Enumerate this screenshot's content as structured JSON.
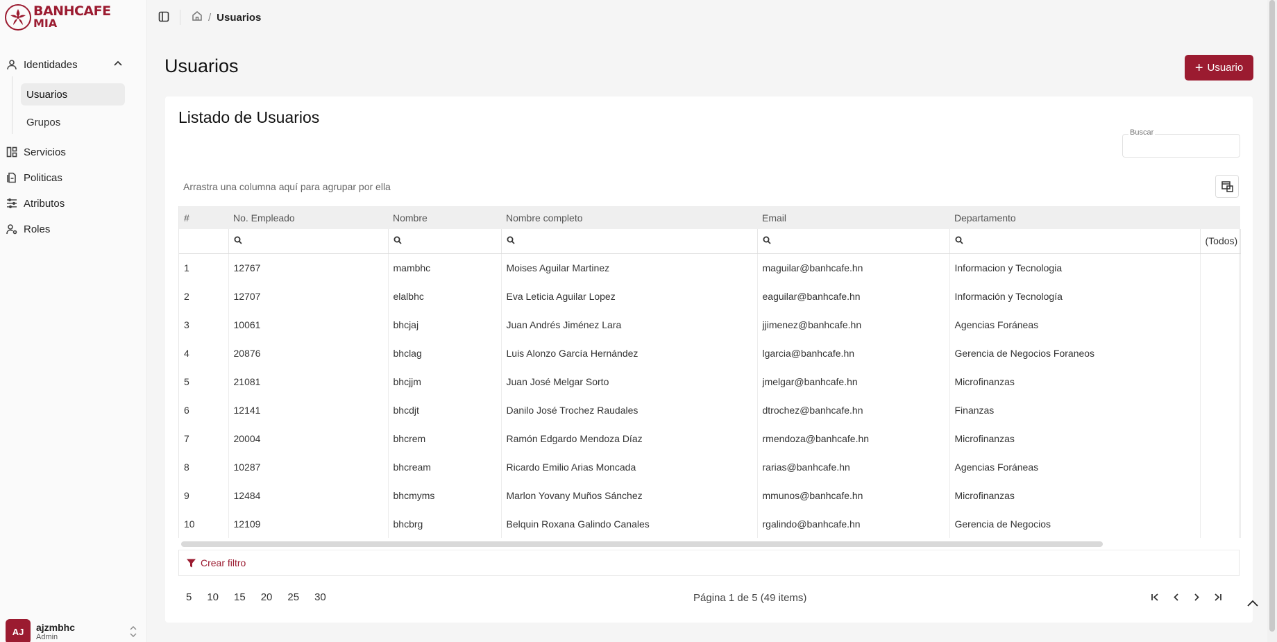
{
  "brand": {
    "line1": "BANHCAFE",
    "line2": "MIA",
    "color": "#9b1b30"
  },
  "sidebar": {
    "items": [
      {
        "label": "Identidades",
        "icon": "user-icon"
      },
      {
        "label": "Servicios",
        "icon": "layout-icon"
      },
      {
        "label": "Politicas",
        "icon": "document-icon"
      },
      {
        "label": "Atributos",
        "icon": "sliders-icon"
      },
      {
        "label": "Roles",
        "icon": "user-cog-icon"
      }
    ],
    "sub_items": [
      "Usuarios",
      "Grupos"
    ],
    "user": {
      "initials": "AJ",
      "name": "ajzmbhc",
      "role": "Admin"
    }
  },
  "breadcrumb": {
    "current": "Usuarios"
  },
  "page": {
    "title": "Usuarios",
    "add_button": "Usuario",
    "card_title": "Listado de Usuarios",
    "search_label": "Buscar",
    "search_value": "",
    "group_hint": "Arrastra una columna aquí para agrupar por ella",
    "create_filter": "Crear filtro"
  },
  "table": {
    "columns": [
      "#",
      "No. Empleado",
      "Nombre",
      "Nombre completo",
      "Email",
      "Departamento"
    ],
    "filter_all": "(Todos)",
    "rows": [
      [
        "1",
        "12767",
        "mambhc",
        "Moises Aguilar Martinez",
        "maguilar@banhcafe.hn",
        "Informacion y Tecnologia"
      ],
      [
        "2",
        "12707",
        "elalbhc",
        "Eva Leticia Aguilar Lopez",
        "eaguilar@banhcafe.hn",
        "Información y Tecnología"
      ],
      [
        "3",
        "10061",
        "bhcjaj",
        "Juan Andrés Jiménez Lara",
        "jjimenez@banhcafe.hn",
        "Agencias Foráneas"
      ],
      [
        "4",
        "20876",
        "bhclag",
        "Luis Alonzo García Hernández",
        "lgarcia@banhcafe.hn",
        "Gerencia de Negocios Foraneos"
      ],
      [
        "5",
        "21081",
        "bhcjjm",
        "Juan José Melgar Sorto",
        "jmelgar@banhcafe.hn",
        "Microfinanzas"
      ],
      [
        "6",
        "12141",
        "bhcdjt",
        "Danilo José Trochez Raudales",
        "dtrochez@banhcafe.hn",
        "Finanzas"
      ],
      [
        "7",
        "20004",
        "bhcrem",
        "Ramón Edgardo Mendoza Díaz",
        "rmendoza@banhcafe.hn",
        "Microfinanzas"
      ],
      [
        "8",
        "10287",
        "bhcream",
        "Ricardo Emilio Arias Moncada",
        "rarias@banhcafe.hn",
        "Agencias Foráneas"
      ],
      [
        "9",
        "12484",
        "bhcmyms",
        "Marlon Yovany Muños Sánchez",
        "mmunos@banhcafe.hn",
        "Microfinanzas"
      ],
      [
        "10",
        "12109",
        "bhcbrg",
        "Belquin Roxana Galindo Canales",
        "rgalindo@banhcafe.hn",
        "Gerencia de Negocios"
      ]
    ]
  },
  "pager": {
    "sizes": [
      "5",
      "10",
      "15",
      "20",
      "25",
      "30"
    ],
    "info": "Página 1 de 5 (49 items)"
  }
}
